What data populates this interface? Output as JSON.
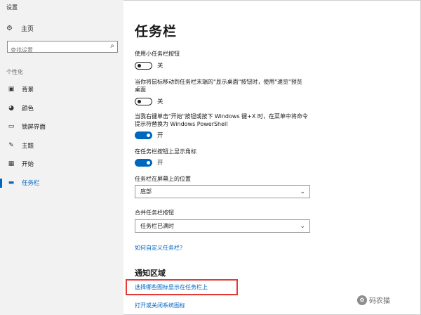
{
  "window": {
    "title": "设置"
  },
  "sidebar": {
    "home_label": "主页",
    "search_placeholder": "查找设置",
    "section_label": "个性化",
    "items": [
      {
        "icon": "image-icon",
        "glyph": "▣",
        "label": "背景"
      },
      {
        "icon": "palette-icon",
        "glyph": "◕",
        "label": "颜色"
      },
      {
        "icon": "lock-screen-icon",
        "glyph": "▭",
        "label": "锁屏界面"
      },
      {
        "icon": "theme-icon",
        "glyph": "✎",
        "label": "主题"
      },
      {
        "icon": "start-icon",
        "glyph": "▦",
        "label": "开始"
      },
      {
        "icon": "taskbar-icon",
        "glyph": "▬",
        "label": "任务栏",
        "active": true
      }
    ]
  },
  "main": {
    "page_title": "任务栏",
    "small_buttons": {
      "label": "使用小任务栏按钮",
      "state": "关"
    },
    "peek": {
      "label": "当你将鼠标移动到任务栏末端的\"显示桌面\"按钮时，使用\"速览\"预览桌面",
      "state": "关"
    },
    "powershell": {
      "label": "当我右键单击\"开始\"按钮或按下 Windows 键+X 时，在菜单中将命令提示符替换为 Windows PowerShell",
      "state": "开"
    },
    "badges": {
      "label": "在任务栏按钮上显示角标",
      "state": "开"
    },
    "location": {
      "label": "任务栏在屏幕上的位置",
      "value": "底部"
    },
    "combine": {
      "label": "合并任务栏按钮",
      "value": "任务栏已满时"
    },
    "customize_link": "如何自定义任务栏?",
    "notification_title": "通知区域",
    "notification_link1": "选择哪些图标显示在任务栏上",
    "notification_link2": "打开或关闭系统图标"
  },
  "watermark": {
    "text": "码农猫"
  },
  "colors": {
    "accent": "#0067c0",
    "highlight": "#e53935"
  }
}
